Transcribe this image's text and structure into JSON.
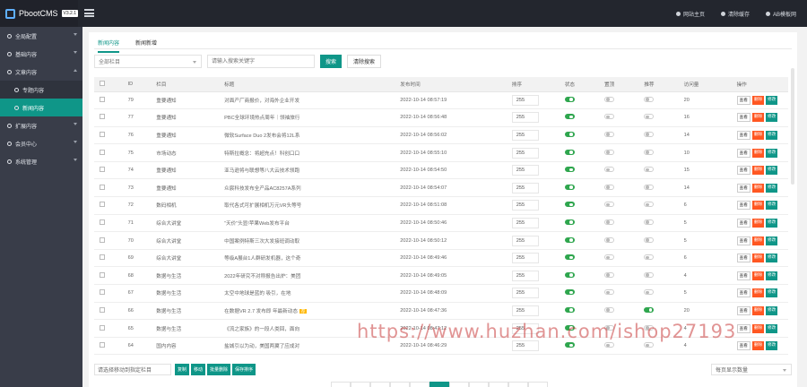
{
  "app": {
    "name": "PbootCMS",
    "version": "V3.2.1"
  },
  "topbar": {
    "items": [
      {
        "icon": "home-icon",
        "label": "网站主页"
      },
      {
        "icon": "trash-icon",
        "label": "清除缓存"
      },
      {
        "icon": "user-icon",
        "label": "AB模板网"
      }
    ]
  },
  "sidebar": {
    "items": [
      {
        "icon": "gear-icon",
        "label": "全局配置",
        "expanded": false
      },
      {
        "icon": "grid-icon",
        "label": "基础内容",
        "expanded": false
      },
      {
        "icon": "file-icon",
        "label": "文章内容",
        "expanded": true
      },
      {
        "icon": "list-icon",
        "label": "专题内容",
        "sub": true
      },
      {
        "icon": "doc-icon",
        "label": "新闻内容",
        "sub": true,
        "active": true
      },
      {
        "icon": "plus-icon",
        "label": "扩展内容",
        "expanded": false
      },
      {
        "icon": "user-icon",
        "label": "会员中心",
        "expanded": false
      },
      {
        "icon": "database-icon",
        "label": "系统管理",
        "expanded": false
      }
    ]
  },
  "tabs": [
    "新闻内容",
    "新闻新增"
  ],
  "filters": {
    "column_select": "全部栏目",
    "keyword_placeholder": "请输入搜索关键字",
    "search_label": "搜索",
    "clear_label": "清除搜索"
  },
  "table": {
    "headers": [
      "",
      "ID",
      "栏目",
      "标题",
      "发布时间",
      "排序",
      "状态",
      "置顶",
      "推荐",
      "访问量",
      "操作"
    ],
    "rows": [
      {
        "id": "79",
        "column": "重要通知",
        "title": "对面产厂商报价，对海外企业开发",
        "time": "2022-10-14 08:57:19",
        "sort": "255",
        "status": true,
        "top": false,
        "rec": false,
        "views": "20"
      },
      {
        "id": "77",
        "column": "重要通知",
        "title": "PBC全球环境热点周年｜领袖旅行",
        "time": "2022-10-14 08:56:48",
        "sort": "255",
        "status": true,
        "top": false,
        "rec": false,
        "views": "16"
      },
      {
        "id": "76",
        "column": "重要通知",
        "title": "微软Surface Duo 2发布会将12L系",
        "time": "2022-10-14 08:56:02",
        "sort": "255",
        "status": true,
        "top": false,
        "rec": false,
        "views": "14"
      },
      {
        "id": "75",
        "column": "市场动态",
        "title": "特斯拉概念：将超充点！科创口口",
        "time": "2022-10-14 08:55:10",
        "sort": "255",
        "status": true,
        "top": false,
        "rec": false,
        "views": "10"
      },
      {
        "id": "74",
        "column": "重要通知",
        "title": "亚马逊将与联想等八大云技术领跑",
        "time": "2022-10-14 08:54:50",
        "sort": "255",
        "status": true,
        "top": false,
        "rec": false,
        "views": "15"
      },
      {
        "id": "73",
        "column": "重要通知",
        "title": "众宸科技发布全产品AC8257A系列",
        "time": "2022-10-14 08:54:07",
        "sort": "255",
        "status": true,
        "top": false,
        "rec": false,
        "views": "14"
      },
      {
        "id": "72",
        "column": "数码相机",
        "title": "取代各式可扩展相机万元VR头等号",
        "time": "2022-10-14 08:51:08",
        "sort": "255",
        "status": true,
        "top": false,
        "rec": false,
        "views": "6"
      },
      {
        "id": "71",
        "column": "综合大讲堂",
        "title": "“天价”头显!苹果Web发布平台",
        "time": "2022-10-14 08:50:46",
        "sort": "255",
        "status": true,
        "top": false,
        "rec": false,
        "views": "5"
      },
      {
        "id": "70",
        "column": "综合大讲堂",
        "title": "中国案例特斯三次大发接班调动取",
        "time": "2022-10-14 08:50:12",
        "sort": "255",
        "status": true,
        "top": false,
        "rec": false,
        "views": "5"
      },
      {
        "id": "69",
        "column": "综合大讲堂",
        "title": "等级A展台1人群研发机器，这个奇",
        "time": "2022-10-14 08:49:46",
        "sort": "255",
        "status": true,
        "top": false,
        "rec": false,
        "views": "6"
      },
      {
        "id": "68",
        "column": "数据与生活",
        "title": "2022年研究不对称报告出炉：美团",
        "time": "2022-10-14 08:49:05",
        "sort": "255",
        "status": true,
        "top": false,
        "rec": false,
        "views": "4"
      },
      {
        "id": "67",
        "column": "数据与生活",
        "title": "太空中地球是蓝的 吸引，在地",
        "time": "2022-10-14 08:48:09",
        "sort": "255",
        "status": true,
        "top": false,
        "rec": false,
        "views": "5"
      },
      {
        "id": "66",
        "column": "数据与生活",
        "title": "在数据VR 2.7 发布即 年最新动态",
        "time": "2022-10-14 08:47:36",
        "sort": "255",
        "status": true,
        "top": false,
        "rec": true,
        "views": "20",
        "tag": "荐"
      },
      {
        "id": "65",
        "column": "数据与生活",
        "title": "《流之家族》的一段人类回，面向",
        "time": "2022-10-14 08:47:12",
        "sort": "255",
        "status": true,
        "top": false,
        "rec": false,
        "views": "4"
      },
      {
        "id": "64",
        "column": "国内内容",
        "title": "盐城引以为动，美国两翼了应成对",
        "time": "2022-10-14 08:46:29",
        "sort": "255",
        "status": true,
        "top": false,
        "rec": false,
        "views": "4"
      }
    ],
    "ops": {
      "view": "查看",
      "del": "删除",
      "edit": "修改"
    }
  },
  "bottom": {
    "move_select": "请选择移动到指定栏目",
    "buttons": [
      "复制",
      "移动",
      "批量删除",
      "保存排序"
    ],
    "per_page": "每页显示数量"
  },
  "watermark": "https://www.huzhan.com/ishop27193",
  "colors": {
    "accent": "#0f9688",
    "danger": "#ff5722",
    "sidebar": "#393d49",
    "topbar": "#23262e"
  }
}
